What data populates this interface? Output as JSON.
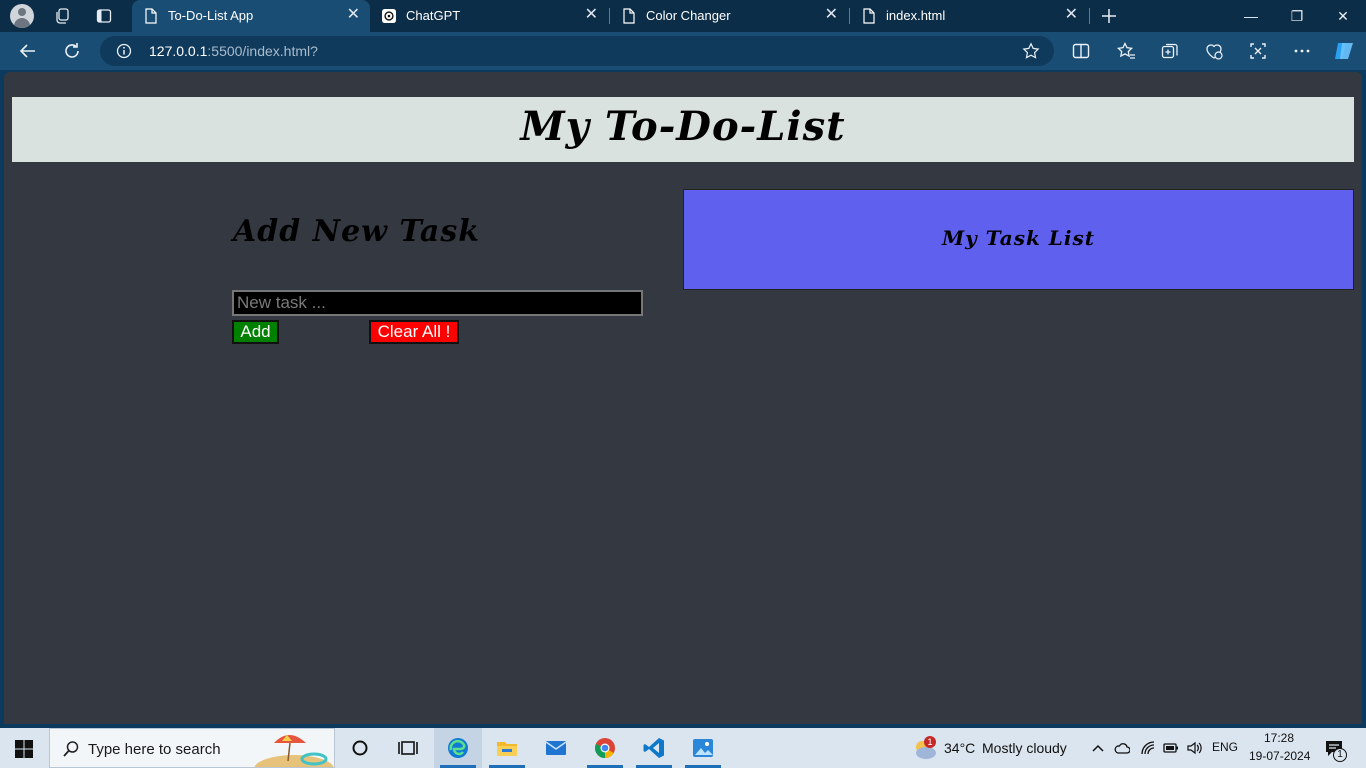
{
  "browser": {
    "tabs": [
      {
        "title": "To-Do-List App",
        "active": true
      },
      {
        "title": "ChatGPT",
        "active": false
      },
      {
        "title": "Color Changer",
        "active": false
      },
      {
        "title": "index.html",
        "active": false
      }
    ],
    "address": {
      "host": "127.0.0.1",
      "rest": ":5500/index.html?"
    }
  },
  "page": {
    "title": "My To-Do-List",
    "add_heading": "Add New Task",
    "input_placeholder": "New task ...",
    "input_value": "",
    "add_button": "Add",
    "clear_button": "Clear All !",
    "task_list_title": "My Task List"
  },
  "colors": {
    "page_bg": "#343941",
    "header_bg": "#d9e2df",
    "add_button": "#008000",
    "clear_button": "#ff0000",
    "task_list_bg": "#6060ee"
  },
  "taskbar": {
    "search_placeholder": "Type here to search",
    "weather": {
      "temp": "34°C",
      "condition": "Mostly cloudy",
      "badge": "1"
    },
    "language": "ENG",
    "time": "17:28",
    "date": "19-07-2024",
    "notification_count": "1"
  }
}
